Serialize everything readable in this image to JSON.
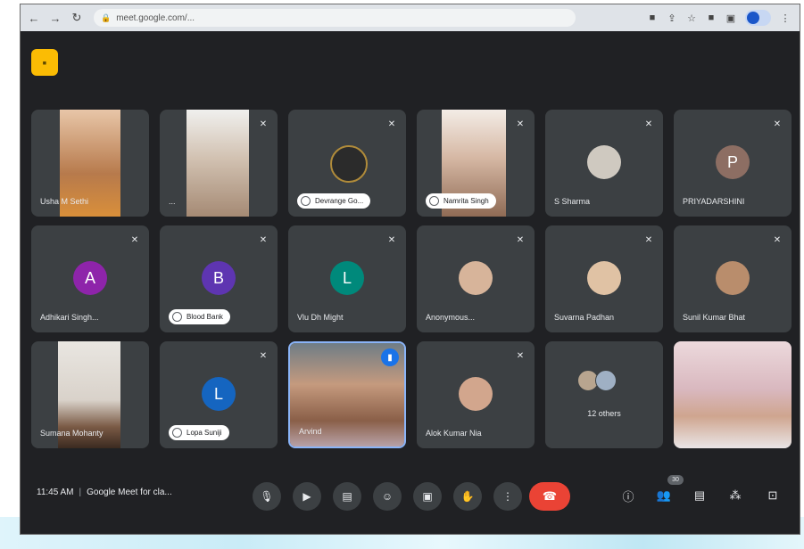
{
  "browser": {
    "url": "meet.google.com/..."
  },
  "tiles": [
    {
      "name": "Usha M Sethi",
      "type": "video"
    },
    {
      "name": "...",
      "type": "video"
    },
    {
      "name": "Devrange Go...",
      "type": "avatar",
      "pill": true
    },
    {
      "name": "Namrita Singh",
      "type": "video",
      "pill": true
    },
    {
      "name": "S Sharma",
      "type": "avatar"
    },
    {
      "name": "PRIYADARSHINI",
      "type": "avatar",
      "initial": "P",
      "color": "#8d6e63"
    },
    {
      "name": "Adhikari Singh...",
      "type": "avatar",
      "initial": "A",
      "color": "#8e24aa"
    },
    {
      "name": "Blood Bank",
      "type": "avatar",
      "initial": "B",
      "color": "#5e35b1",
      "pill": true
    },
    {
      "name": "Vlu Dh Might",
      "type": "avatar",
      "initial": "L",
      "color": "#00897b"
    },
    {
      "name": "Anonymous...",
      "type": "avatar"
    },
    {
      "name": "Suvarna Padhan",
      "type": "avatar"
    },
    {
      "name": "Sunil Kumar Bhat",
      "type": "avatar"
    },
    {
      "name": "Sumana Mohanty",
      "type": "video"
    },
    {
      "name": "Lopa Suniji",
      "type": "avatar",
      "initial": "L",
      "color": "#1565c0",
      "pill": true
    },
    {
      "name": "Arvind",
      "type": "video",
      "active": true
    },
    {
      "name": "Alok Kumar Nia",
      "type": "avatar"
    },
    {
      "name": "12 others",
      "type": "others"
    },
    {
      "name": "",
      "type": "video"
    }
  ],
  "bottom": {
    "time": "11:45 AM",
    "meeting": "Google Meet for cla...",
    "participants_count": "30"
  },
  "colors": {
    "background": "#202124",
    "tile": "#3c4043",
    "hangup": "#ea4335",
    "speaking": "#1a73e8"
  }
}
